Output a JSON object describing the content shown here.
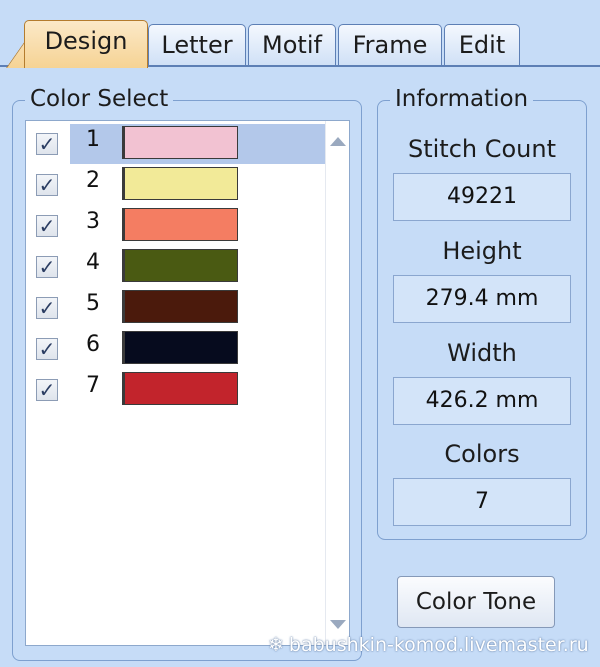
{
  "tabs": [
    {
      "label": "Design",
      "active": true
    },
    {
      "label": "Letter"
    },
    {
      "label": "Motif"
    },
    {
      "label": "Frame"
    },
    {
      "label": "Edit"
    }
  ],
  "color_select": {
    "title": "Color Select",
    "items": [
      {
        "number": "1",
        "checked": "✓",
        "color": "#f2c2d2",
        "selected": true
      },
      {
        "number": "2",
        "checked": "✓",
        "color": "#f2ea98"
      },
      {
        "number": "3",
        "checked": "✓",
        "color": "#f47d62"
      },
      {
        "number": "4",
        "checked": "✓",
        "color": "#4a5a12"
      },
      {
        "number": "5",
        "checked": "✓",
        "color": "#4b1a0c"
      },
      {
        "number": "6",
        "checked": "✓",
        "color": "#060b1e"
      },
      {
        "number": "7",
        "checked": "✓",
        "color": "#c2242c"
      }
    ]
  },
  "information": {
    "title": "Information",
    "stitch_count_label": "Stitch Count",
    "stitch_count_value": "49221",
    "height_label": "Height",
    "height_value": "279.4 mm",
    "width_label": "Width",
    "width_value": "426.2 mm",
    "colors_label": "Colors",
    "colors_value": "7"
  },
  "color_tone_button": "Color Tone",
  "watermark": "babushkin-komod.livemaster.ru"
}
